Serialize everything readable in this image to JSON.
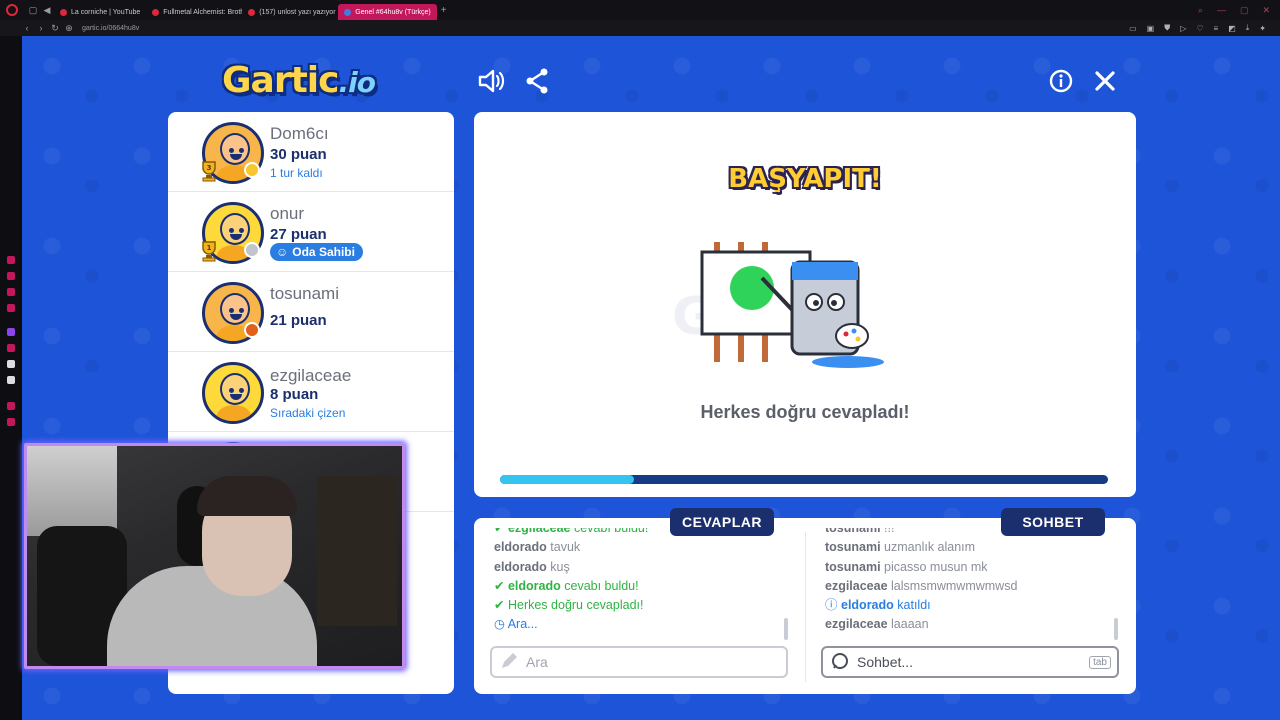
{
  "browser": {
    "tabs": [
      {
        "label": "La corniche | YouTube",
        "color": "#e0263b",
        "active": false
      },
      {
        "label": "Fullmetal Alchemist: Broth",
        "color": "#e0263b",
        "active": false
      },
      {
        "label": "(157) unlost yazı yazıyor",
        "color": "#e0263b",
        "active": false
      },
      {
        "label": "Genel #64hu8v (Türkçe)",
        "color": "#3c7fe0",
        "active": true
      }
    ],
    "url": "gartic.io/0664hu8v"
  },
  "header": {
    "logo_main": "Gartic",
    "logo_suffix": ".io"
  },
  "players": [
    {
      "name": "Dom6cı",
      "points": "30 puan",
      "sub": "1 tur kaldı",
      "rank": "3",
      "dot_color": "#f7c72b",
      "owner": false
    },
    {
      "name": "onur",
      "points": "27 puan",
      "sub": "",
      "rank": "1",
      "dot_color": "#c0c4cc",
      "owner": true,
      "owner_label": "Oda Sahibi"
    },
    {
      "name": "tosunami",
      "points": "21 puan",
      "sub": "",
      "rank": "",
      "dot_color": "#e0611b",
      "owner": false
    },
    {
      "name": "ezgilaceae",
      "points": "8 puan",
      "sub": "Sıradaki çizen",
      "rank": "",
      "dot_color": "",
      "owner": false
    }
  ],
  "stage": {
    "title": "BAŞYAPIT!",
    "message": "Herkes doğru cevapladı!",
    "progress": 0.22
  },
  "answers": {
    "tab_label": "CEVAPLAR",
    "lines": [
      {
        "user": "ezgilaceae",
        "text": "cevabı buldu!",
        "kind": "ok"
      },
      {
        "user": "eldorado",
        "text": "tavuk",
        "kind": "normal"
      },
      {
        "user": "eldorado",
        "text": "kuş",
        "kind": "normal"
      },
      {
        "user": "eldorado",
        "text": "cevabı buldu!",
        "kind": "ok"
      },
      {
        "user": "",
        "text": "Herkes doğru cevapladı!",
        "kind": "ok"
      },
      {
        "user": "",
        "text": "Ara...",
        "kind": "info"
      }
    ],
    "input_placeholder": "Ara"
  },
  "chat": {
    "tab_label": "SOHBET",
    "lines": [
      {
        "user": "tosunami",
        "text": "!!!"
      },
      {
        "user": "tosunami",
        "text": "uzmanlık alanım"
      },
      {
        "user": "tosunami",
        "text": "picasso musun mk"
      },
      {
        "user": "ezgilaceae",
        "text": "lalsmsmwmwmwmwsd"
      },
      {
        "user": "eldorado",
        "text": "katıldı",
        "kind": "info"
      },
      {
        "user": "ezgilaceae",
        "text": "laaaan"
      }
    ],
    "input_placeholder": "Sohbet...",
    "key_hint": "tab"
  }
}
